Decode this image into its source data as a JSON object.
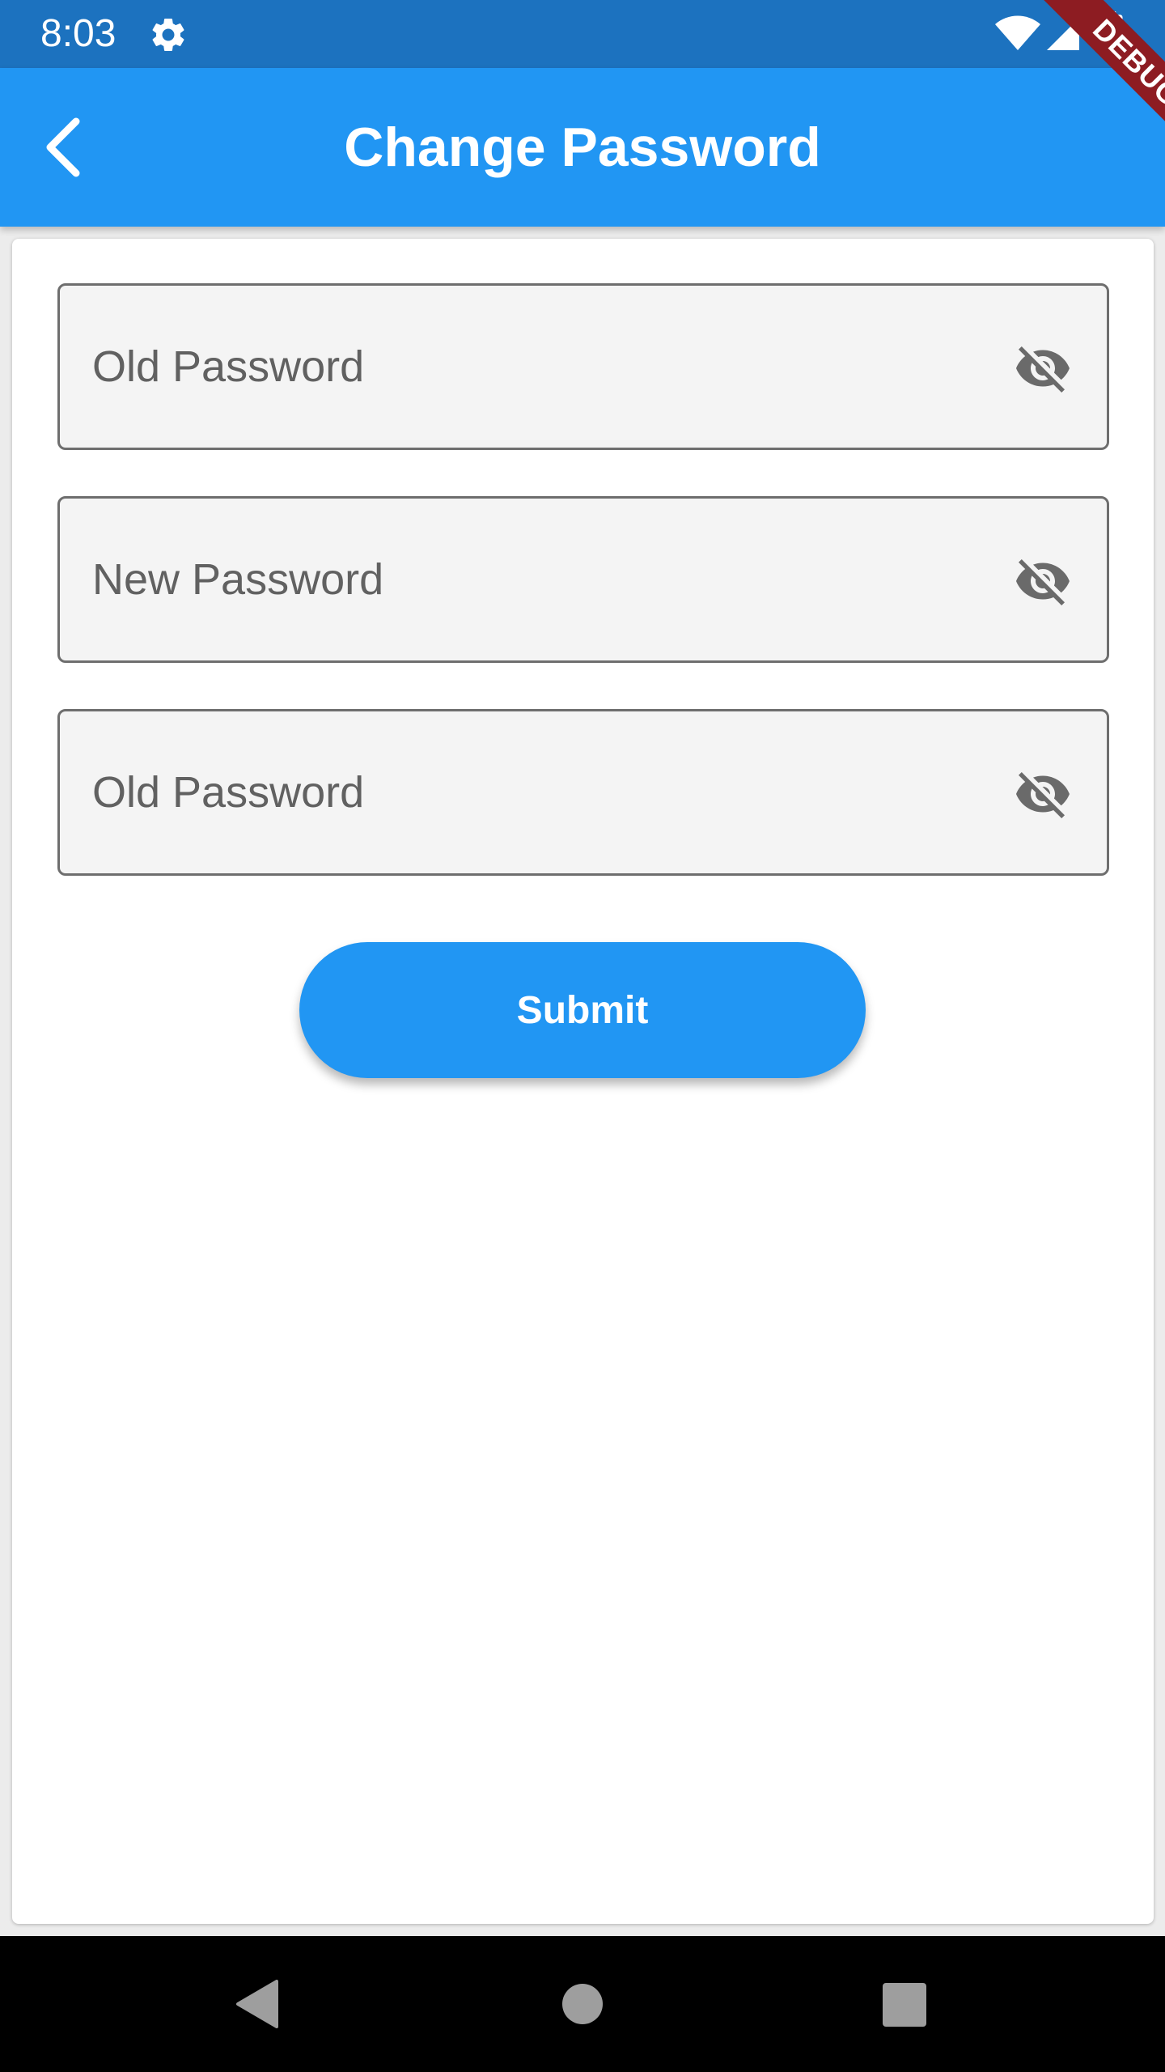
{
  "status_bar": {
    "time": "8:03",
    "icons": [
      "gear-icon",
      "wifi-icon",
      "signal-icon",
      "battery-icon"
    ]
  },
  "app_bar": {
    "title": "Change Password",
    "back_icon": "chevron-left-icon",
    "color": "#2196f3"
  },
  "debug_banner": {
    "label": "DEBUG",
    "color": "#8d1c22"
  },
  "form": {
    "fields": [
      {
        "placeholder": "Old Password",
        "value": "",
        "toggle_icon": "eye-off-icon"
      },
      {
        "placeholder": "New Password",
        "value": "",
        "toggle_icon": "eye-off-icon"
      },
      {
        "placeholder": "Old Password",
        "value": "",
        "toggle_icon": "eye-off-icon"
      }
    ],
    "submit_label": "Submit"
  },
  "nav_bar": {
    "icons": [
      "back-triangle-icon",
      "home-circle-icon",
      "recents-square-icon"
    ]
  },
  "colors": {
    "status_bar": "#1c72bf",
    "accent": "#2196f3",
    "field_background": "#f4f4f4",
    "field_border": "#6e6e6e"
  }
}
